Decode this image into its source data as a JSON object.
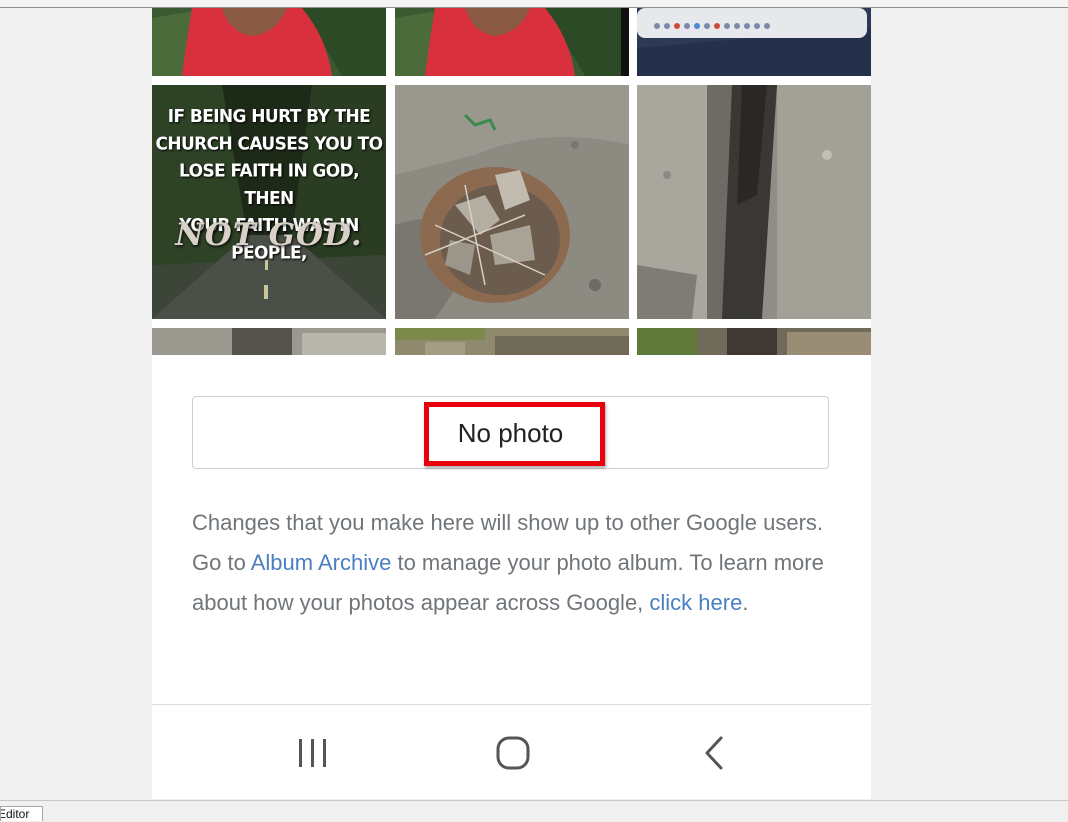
{
  "photo_grid": {
    "quote_tile": {
      "lines": [
        "IF BEING HURT BY THE",
        "CHURCH CAUSES YOU TO",
        "LOSE FAITH IN GOD, THEN",
        "YOUR FAITH WAS IN PEOPLE,"
      ],
      "emphasis": "NOT GOD."
    }
  },
  "no_photo_button": {
    "label": "No photo"
  },
  "info_text": {
    "part1": "Changes that you make here will show up to other Google users. Go to ",
    "album_archive_link": "Album Archive",
    "part2": " to manage your photo album. To learn more about how your photos appear across Google, ",
    "click_here_link": "click here",
    "part3": "."
  },
  "nav_bar": {
    "icons": [
      "recent-apps-icon",
      "home-icon",
      "back-icon"
    ]
  },
  "taskbar": {
    "tab_label": "Editor"
  },
  "colors": {
    "highlight": "#e8000b",
    "link": "#4a7fc1",
    "text_muted": "#70757a"
  }
}
